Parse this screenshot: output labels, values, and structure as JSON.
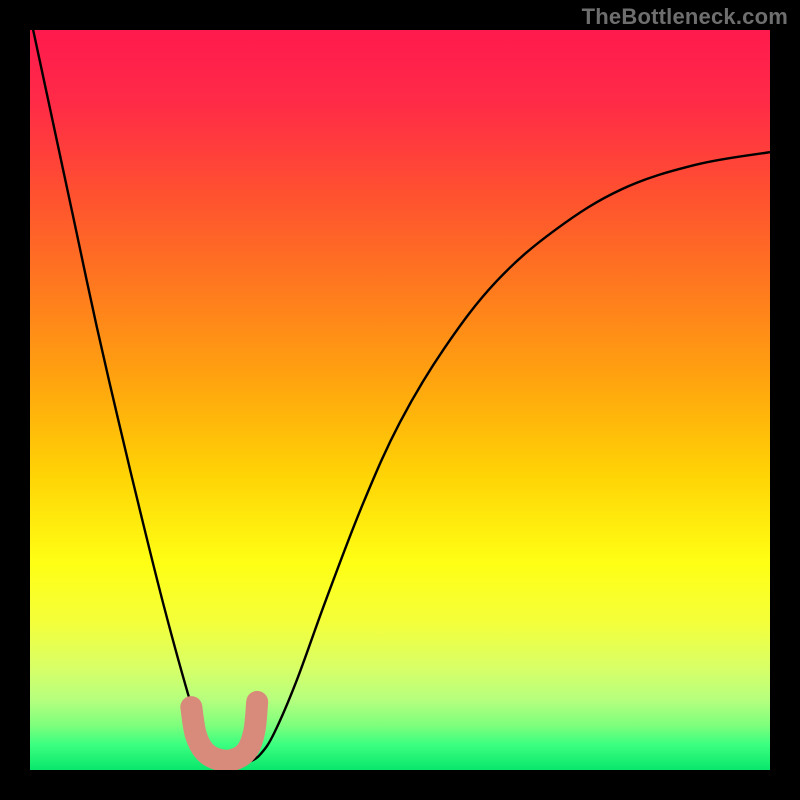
{
  "watermark": "TheBottleneck.com",
  "gradient": {
    "stops": [
      {
        "offset": 0.0,
        "color": "#ff1a4d"
      },
      {
        "offset": 0.1,
        "color": "#ff2b47"
      },
      {
        "offset": 0.22,
        "color": "#ff5030"
      },
      {
        "offset": 0.35,
        "color": "#ff7a1e"
      },
      {
        "offset": 0.48,
        "color": "#ffa60e"
      },
      {
        "offset": 0.6,
        "color": "#ffd305"
      },
      {
        "offset": 0.72,
        "color": "#ffff14"
      },
      {
        "offset": 0.8,
        "color": "#f4ff3a"
      },
      {
        "offset": 0.86,
        "color": "#d9ff66"
      },
      {
        "offset": 0.905,
        "color": "#b6ff7e"
      },
      {
        "offset": 0.94,
        "color": "#7dff7d"
      },
      {
        "offset": 0.965,
        "color": "#3dff80"
      },
      {
        "offset": 1.0,
        "color": "#08e76c"
      }
    ]
  },
  "chart_data": {
    "type": "line",
    "title": "",
    "xlabel": "",
    "ylabel": "",
    "xlim": [
      0,
      1
    ],
    "ylim": [
      0,
      1
    ],
    "note": "Axes are implicit (no tick labels shown). Values are normalized coordinates read off the plot area; y=1 is top, y=0 is bottom.",
    "series": [
      {
        "name": "curve",
        "x": [
          0.0,
          0.03,
          0.06,
          0.09,
          0.12,
          0.15,
          0.18,
          0.21,
          0.225,
          0.24,
          0.255,
          0.27,
          0.285,
          0.298,
          0.312,
          0.33,
          0.36,
          0.4,
          0.45,
          0.5,
          0.56,
          0.63,
          0.71,
          0.8,
          0.9,
          1.0
        ],
        "y": [
          1.02,
          0.88,
          0.74,
          0.6,
          0.47,
          0.345,
          0.225,
          0.115,
          0.068,
          0.038,
          0.02,
          0.012,
          0.01,
          0.012,
          0.022,
          0.05,
          0.12,
          0.23,
          0.36,
          0.47,
          0.57,
          0.66,
          0.73,
          0.785,
          0.818,
          0.835
        ],
        "stroke": "#000000",
        "stroke_width": 2.4
      },
      {
        "name": "marker-bracket",
        "x": [
          0.218,
          0.224,
          0.236,
          0.255,
          0.275,
          0.293,
          0.303,
          0.307
        ],
        "y": [
          0.085,
          0.048,
          0.025,
          0.014,
          0.014,
          0.026,
          0.052,
          0.092
        ],
        "stroke": "#d98b7b",
        "stroke_width": 22,
        "linecap": "round"
      }
    ]
  }
}
